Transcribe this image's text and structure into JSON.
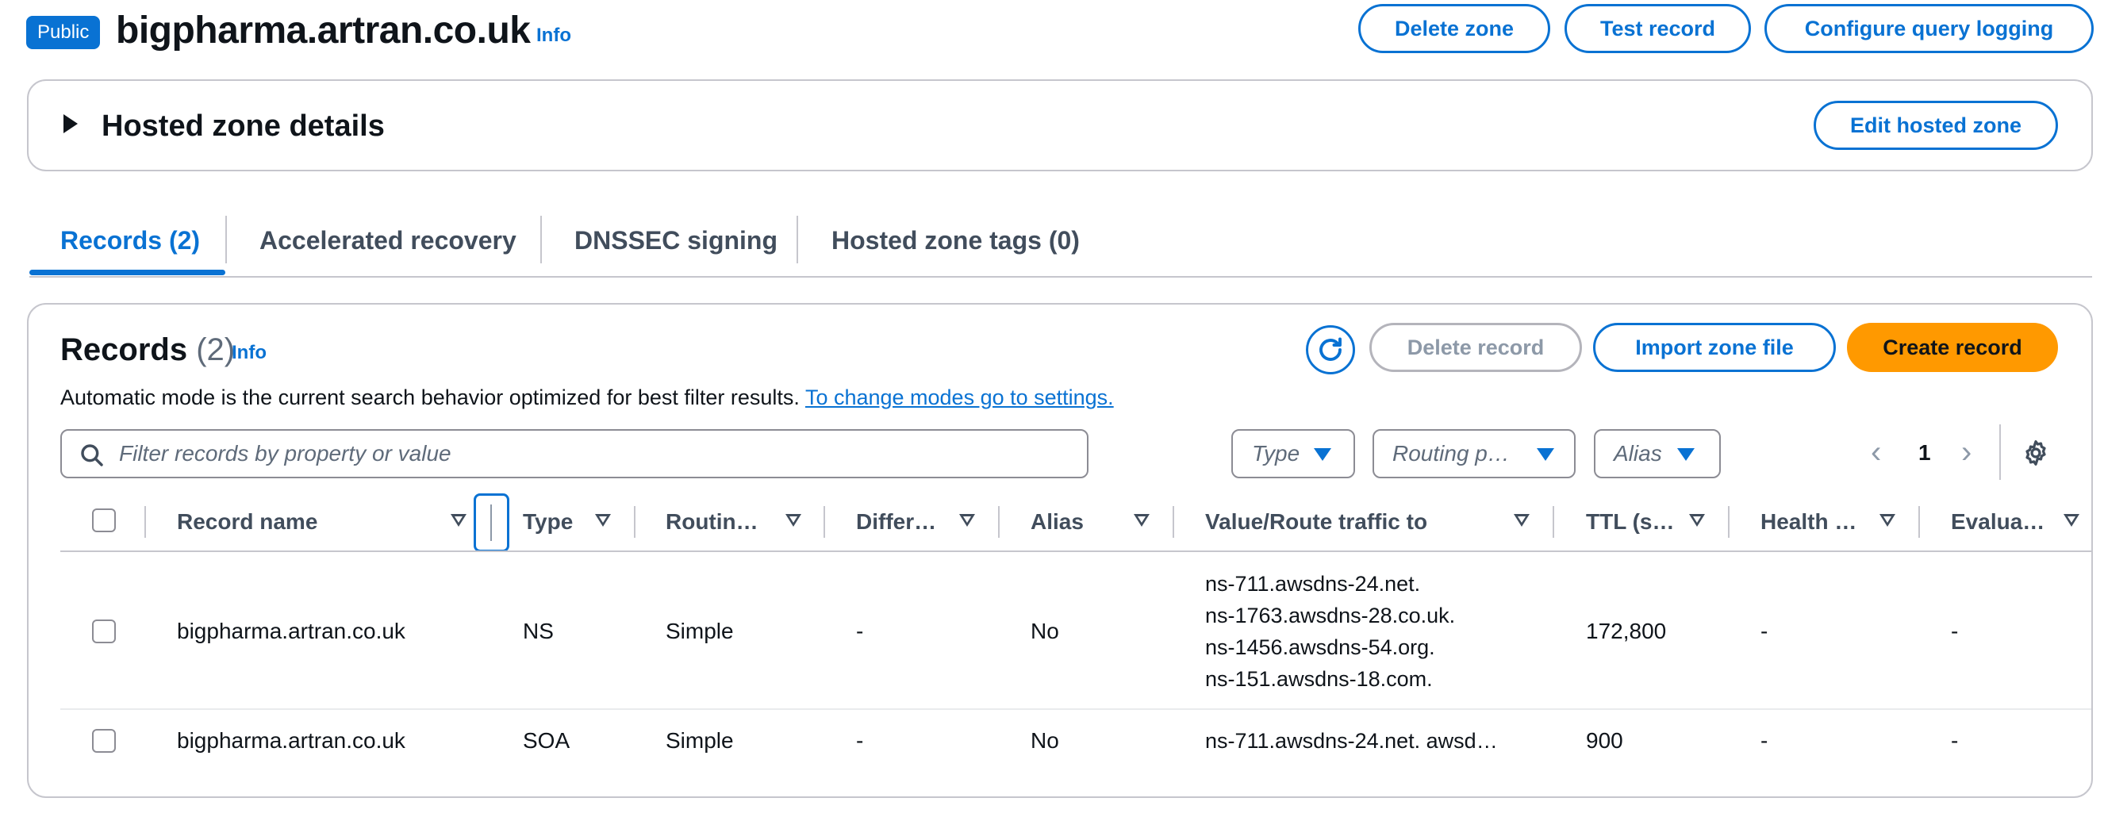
{
  "header": {
    "badge": "Public",
    "title": "bigpharma.artran.co.uk",
    "info": "Info",
    "buttons": {
      "delete_zone": "Delete zone",
      "test_record": "Test record",
      "configure_query_logging": "Configure query logging"
    }
  },
  "details": {
    "title": "Hosted zone details",
    "edit_button": "Edit hosted zone"
  },
  "tabs": [
    {
      "label": "Records (2)",
      "active": true
    },
    {
      "label": "Accelerated recovery",
      "active": false
    },
    {
      "label": "DNSSEC signing",
      "active": false
    },
    {
      "label": "Hosted zone tags (0)",
      "active": false
    }
  ],
  "records": {
    "title": "Records",
    "count": "(2)",
    "info": "Info",
    "description": "Automatic mode is the current search behavior optimized for best filter results.",
    "description_link": "To change modes go to settings.",
    "buttons": {
      "delete_record": "Delete record",
      "import_zone_file": "Import zone file",
      "create_record": "Create record"
    },
    "search_placeholder": "Filter records by property or value",
    "filters": {
      "type": "Type",
      "routing": "Routing p…",
      "alias": "Alias"
    },
    "pagination": {
      "current_page": "1"
    },
    "columns": [
      "Record name",
      "Type",
      "Routin…",
      "Differ…",
      "Alias",
      "Value/Route traffic to",
      "TTL (s…",
      "Health …",
      "Evalua…"
    ],
    "rows": [
      {
        "name": "bigpharma.artran.co.uk",
        "type": "NS",
        "routing": "Simple",
        "differentiator": "-",
        "alias": "No",
        "values": [
          "ns-711.awsdns-24.net.",
          "ns-1763.awsdns-28.co.uk.",
          "ns-1456.awsdns-54.org.",
          "ns-151.awsdns-18.com."
        ],
        "ttl": "172,800",
        "health": "-",
        "evaluate": "-"
      },
      {
        "name": "bigpharma.artran.co.uk",
        "type": "SOA",
        "routing": "Simple",
        "differentiator": "-",
        "alias": "No",
        "values": [
          "ns-711.awsdns-24.net. awsd…"
        ],
        "ttl": "900",
        "health": "-",
        "evaluate": "-"
      }
    ]
  },
  "colors": {
    "accent": "#0972d3",
    "primary_button": "#ff9900",
    "border": "#c6c6cd"
  }
}
